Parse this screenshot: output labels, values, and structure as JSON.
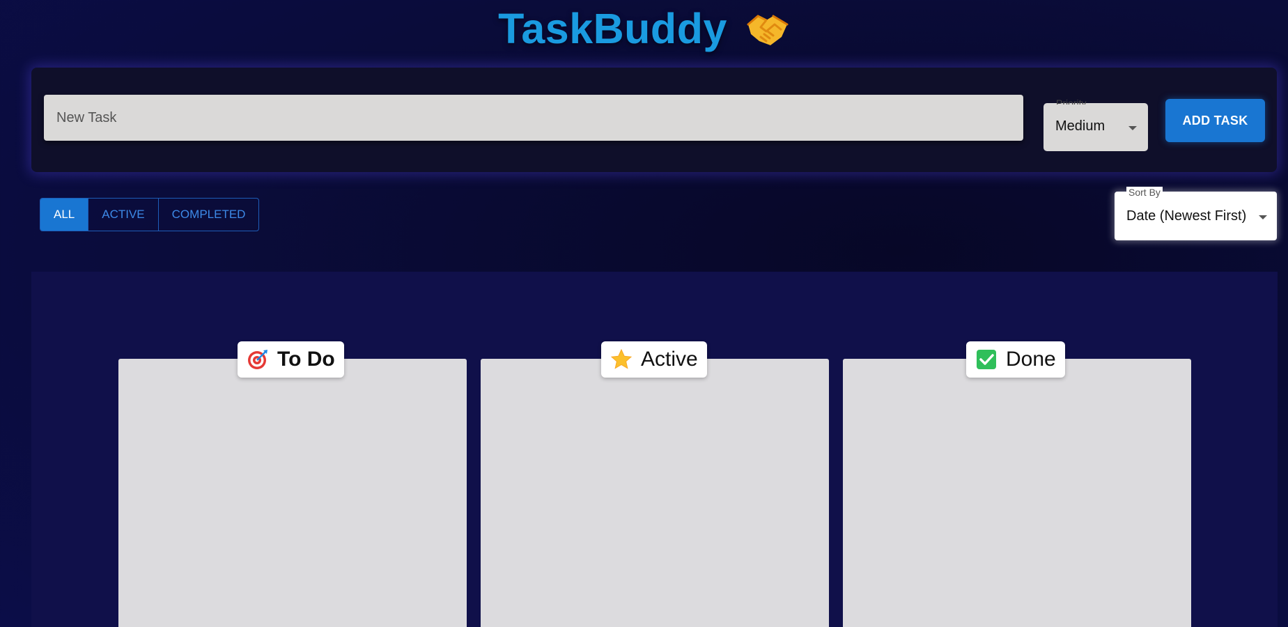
{
  "app": {
    "title": "TaskBuddy",
    "title_icon": "handshake-icon",
    "accent_color": "#1a9be0"
  },
  "task_form": {
    "input_placeholder": "New Task",
    "input_value": "",
    "priority_label": "Priority",
    "priority_value": "Medium",
    "add_button_label": "ADD TASK",
    "button_color": "#1976d2"
  },
  "filters": {
    "options": [
      "ALL",
      "ACTIVE",
      "COMPLETED"
    ],
    "selected": "ALL"
  },
  "sort": {
    "label": "Sort By",
    "value": "Date (Newest First)"
  },
  "board": {
    "columns": [
      {
        "title": "To Do",
        "icon": "target-icon"
      },
      {
        "title": "Active",
        "icon": "star-icon"
      },
      {
        "title": "Done",
        "icon": "check-box-icon"
      }
    ]
  }
}
